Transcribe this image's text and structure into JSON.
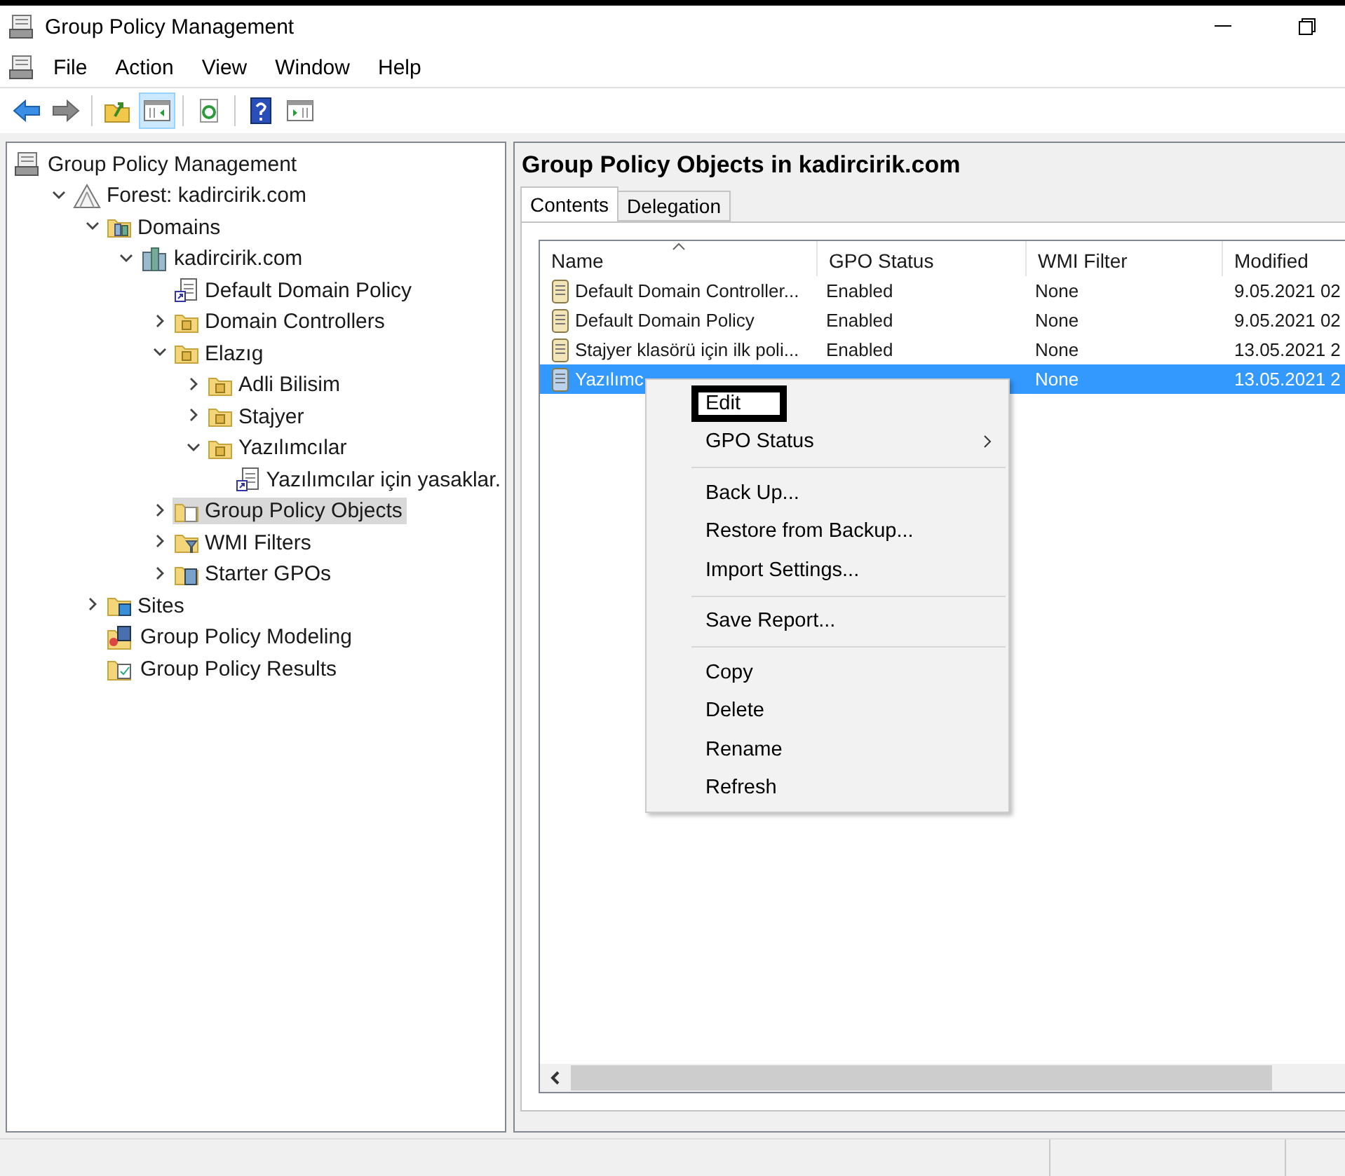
{
  "window": {
    "title": "Group Policy Management"
  },
  "menu": [
    "File",
    "Action",
    "View",
    "Window",
    "Help"
  ],
  "toolbar": [
    {
      "kind": "back"
    },
    {
      "kind": "forward"
    },
    {
      "kind": "sep"
    },
    {
      "kind": "up",
      "selected": false
    },
    {
      "kind": "pane",
      "selected": true
    },
    {
      "kind": "sep"
    },
    {
      "kind": "refresh",
      "selected": false
    },
    {
      "kind": "sep"
    },
    {
      "kind": "help",
      "selected": false
    },
    {
      "kind": "panel",
      "selected": false
    }
  ],
  "tree": [
    {
      "label": "Group Policy Management",
      "kind": "console",
      "selected": false,
      "children": [
        {
          "label": "Forest: kadircirik.com",
          "kind": "forest",
          "expanded": true,
          "selected": false,
          "children": [
            {
              "label": "Domains",
              "kind": "domains",
              "expanded": true,
              "selected": false,
              "children": [
                {
                  "label": "kadircirik.com",
                  "kind": "domain",
                  "expanded": true,
                  "selected": false,
                  "children": [
                    {
                      "label": "Default Domain Policy",
                      "kind": "link",
                      "selected": false
                    },
                    {
                      "label": "Domain Controllers",
                      "kind": "ou",
                      "expanded": false,
                      "selected": false
                    },
                    {
                      "label": "Elazıg",
                      "kind": "ou",
                      "expanded": true,
                      "selected": false,
                      "children": [
                        {
                          "label": "Adli Bilisim",
                          "kind": "ou",
                          "expanded": false,
                          "selected": false
                        },
                        {
                          "label": "Stajyer",
                          "kind": "ou",
                          "expanded": false,
                          "selected": false
                        },
                        {
                          "label": "Yazılımcılar",
                          "kind": "ou",
                          "expanded": true,
                          "selected": false,
                          "children": [
                            {
                              "label": "Yazılımcılar için yasaklar.",
                              "kind": "link",
                              "selected": false
                            }
                          ]
                        }
                      ]
                    },
                    {
                      "label": "Group Policy Objects",
                      "kind": "gpofolder",
                      "expanded": false,
                      "selected": true
                    },
                    {
                      "label": "WMI Filters",
                      "kind": "wmifolder",
                      "expanded": false,
                      "selected": false
                    },
                    {
                      "label": "Starter GPOs",
                      "kind": "starterfolder",
                      "expanded": false,
                      "selected": false
                    }
                  ]
                }
              ]
            },
            {
              "label": "Sites",
              "kind": "sites",
              "expanded": false,
              "selected": false
            },
            {
              "label": "Group Policy Modeling",
              "kind": "modeling",
              "selected": false
            },
            {
              "label": "Group Policy Results",
              "kind": "results",
              "selected": false
            }
          ]
        }
      ]
    }
  ],
  "details": {
    "title": "Group Policy Objects in kadircirik.com",
    "tabs": [
      {
        "label": "Contents",
        "selected": true
      },
      {
        "label": "Delegation",
        "selected": false
      }
    ],
    "columns": [
      "Name",
      "GPO Status",
      "WMI Filter",
      "Modified"
    ],
    "rows": [
      {
        "name": "Default Domain Controller...",
        "gpo_status": "Enabled",
        "wmi_filter": "None",
        "modified": "9.05.2021 02",
        "selected": false
      },
      {
        "name": "Default Domain Policy",
        "gpo_status": "Enabled",
        "wmi_filter": "None",
        "modified": "9.05.2021 02",
        "selected": false
      },
      {
        "name": "Stajyer klasörü için ilk poli...",
        "gpo_status": "Enabled",
        "wmi_filter": "None",
        "modified": "13.05.2021 2",
        "selected": false
      },
      {
        "name": "Yazılımc",
        "wmi_filter": "None",
        "modified": "13.05.2021 2",
        "selected": true
      }
    ]
  },
  "context_menu": [
    {
      "kind": "item",
      "label": "Edit",
      "outlined": true
    },
    {
      "kind": "submenu",
      "label": "GPO Status",
      "outlined": false
    },
    {
      "kind": "separator"
    },
    {
      "kind": "item",
      "label": "Back Up...",
      "outlined": false
    },
    {
      "kind": "item",
      "label": "Restore from Backup...",
      "outlined": false
    },
    {
      "kind": "item",
      "label": "Import Settings...",
      "outlined": false
    },
    {
      "kind": "separator"
    },
    {
      "kind": "item",
      "label": "Save Report...",
      "outlined": false
    },
    {
      "kind": "separator"
    },
    {
      "kind": "item",
      "label": "Copy",
      "outlined": false
    },
    {
      "kind": "item",
      "label": "Delete",
      "outlined": false
    },
    {
      "kind": "item",
      "label": "Rename",
      "outlined": false
    },
    {
      "kind": "item",
      "label": "Refresh",
      "outlined": false
    }
  ]
}
